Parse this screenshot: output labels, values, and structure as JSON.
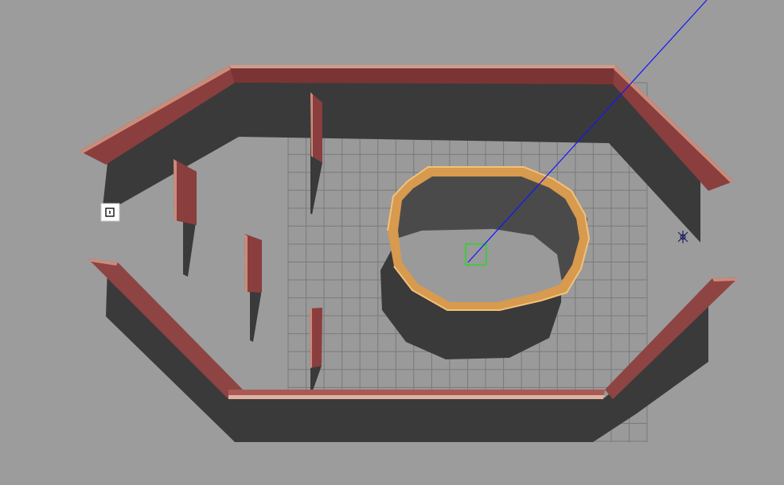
{
  "app": {
    "kind": "3d-simulator-viewport",
    "background_color": "#9c9c9c"
  },
  "scene": {
    "ground_grid_color": "#7f7f7f",
    "floor_color": "#9a9a9a",
    "shadow_color": "#3a3a3a",
    "wall_color": "#8a3e3e",
    "wall_highlight": "#c98c7a",
    "pen_color": "#d79a4e",
    "pen_highlight": "#f2c27a",
    "ray_color": "#1414ff",
    "selection_color": "#27d627"
  },
  "icons": {
    "origin_marker": "origin-marker-icon",
    "light_source": "light-source-icon"
  }
}
